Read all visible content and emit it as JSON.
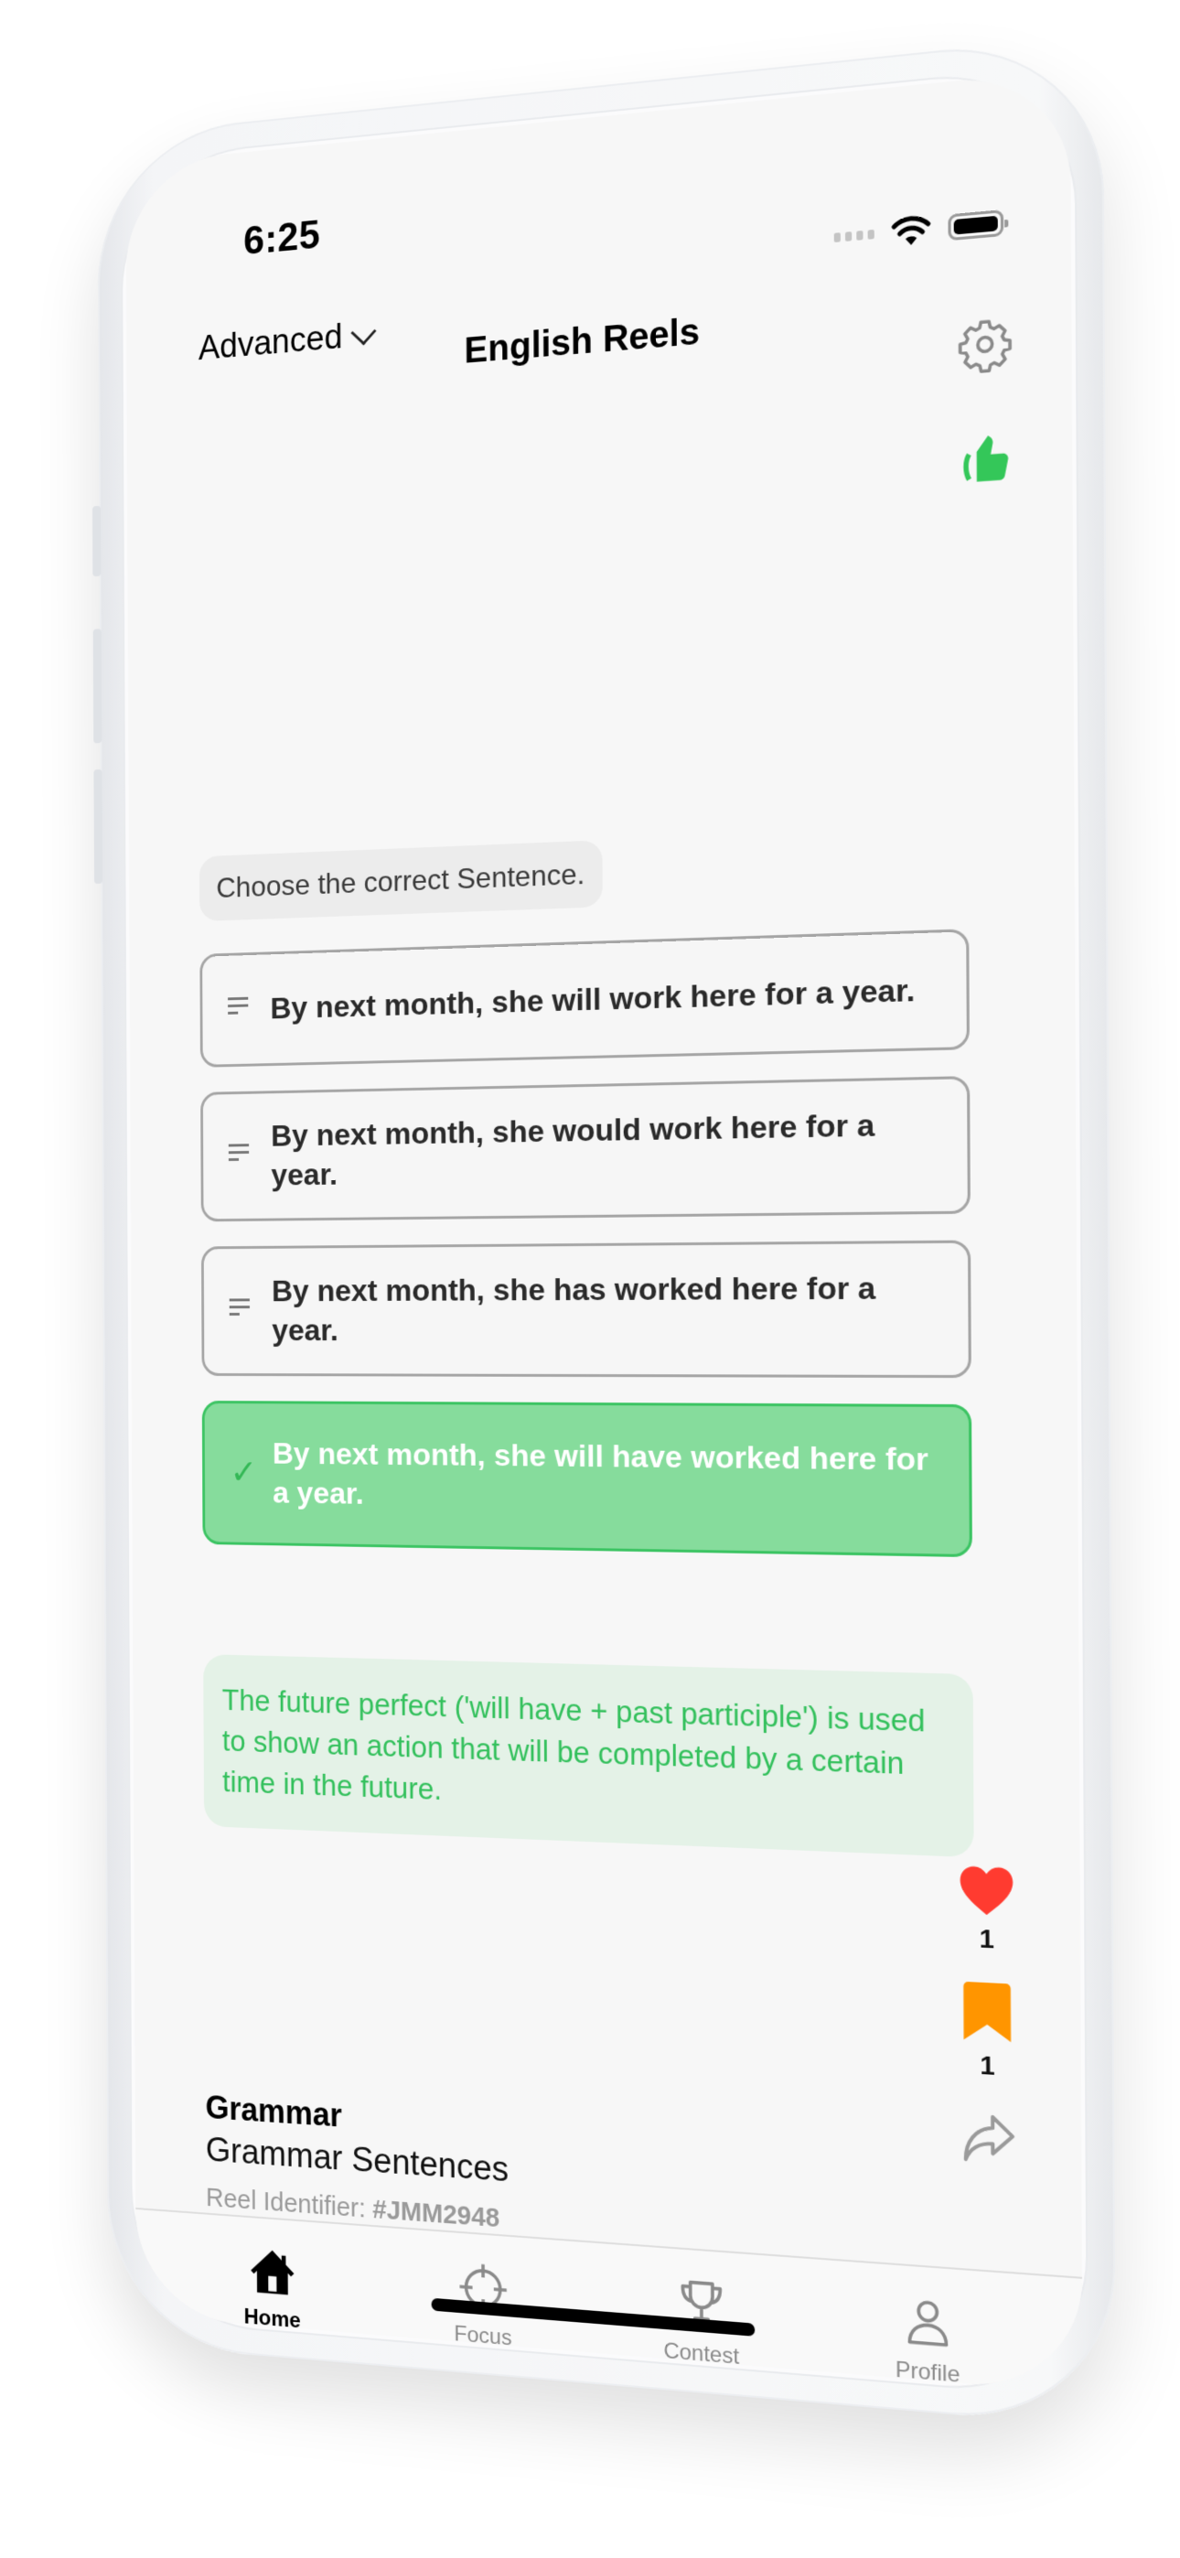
{
  "status_bar": {
    "time": "6:25"
  },
  "header": {
    "level_label": "Advanced",
    "title": "English Reels",
    "settings_icon": "gear-icon",
    "like_icon": "thumbs-up-icon"
  },
  "question": {
    "prompt": "Choose the correct Sentence.",
    "options": [
      {
        "text": "By next month, she will work here for a year.",
        "state": "neutral"
      },
      {
        "text": "By next month, she would work here for a year.",
        "state": "neutral"
      },
      {
        "text": "By next month, she has worked here for a year.",
        "state": "neutral"
      },
      {
        "text": "By next month, she will have worked here for a year.",
        "state": "correct"
      }
    ],
    "explanation": "The future perfect ('will have + past participle') is used to show an action that will be completed by a certain time in the future."
  },
  "actions": {
    "likes": "1",
    "bookmarks": "1"
  },
  "reel": {
    "category": "Grammar",
    "subcategory": "Grammar Sentences",
    "identifier_label": "Reel Identifier:",
    "identifier_value": "#JMM2948"
  },
  "tabs": [
    {
      "label": "Home",
      "icon": "home-icon",
      "active": true
    },
    {
      "label": "Focus",
      "icon": "crosshair-icon",
      "active": false
    },
    {
      "label": "Contest",
      "icon": "trophy-icon",
      "active": false
    },
    {
      "label": "Profile",
      "icon": "person-icon",
      "active": false
    }
  ],
  "colors": {
    "accent_green": "#34C759",
    "correct_fill": "#86DC9C",
    "explanation_bg": "#E4F2E7",
    "heart_red": "#FF3B30",
    "bookmark_orange": "#FF9500"
  }
}
